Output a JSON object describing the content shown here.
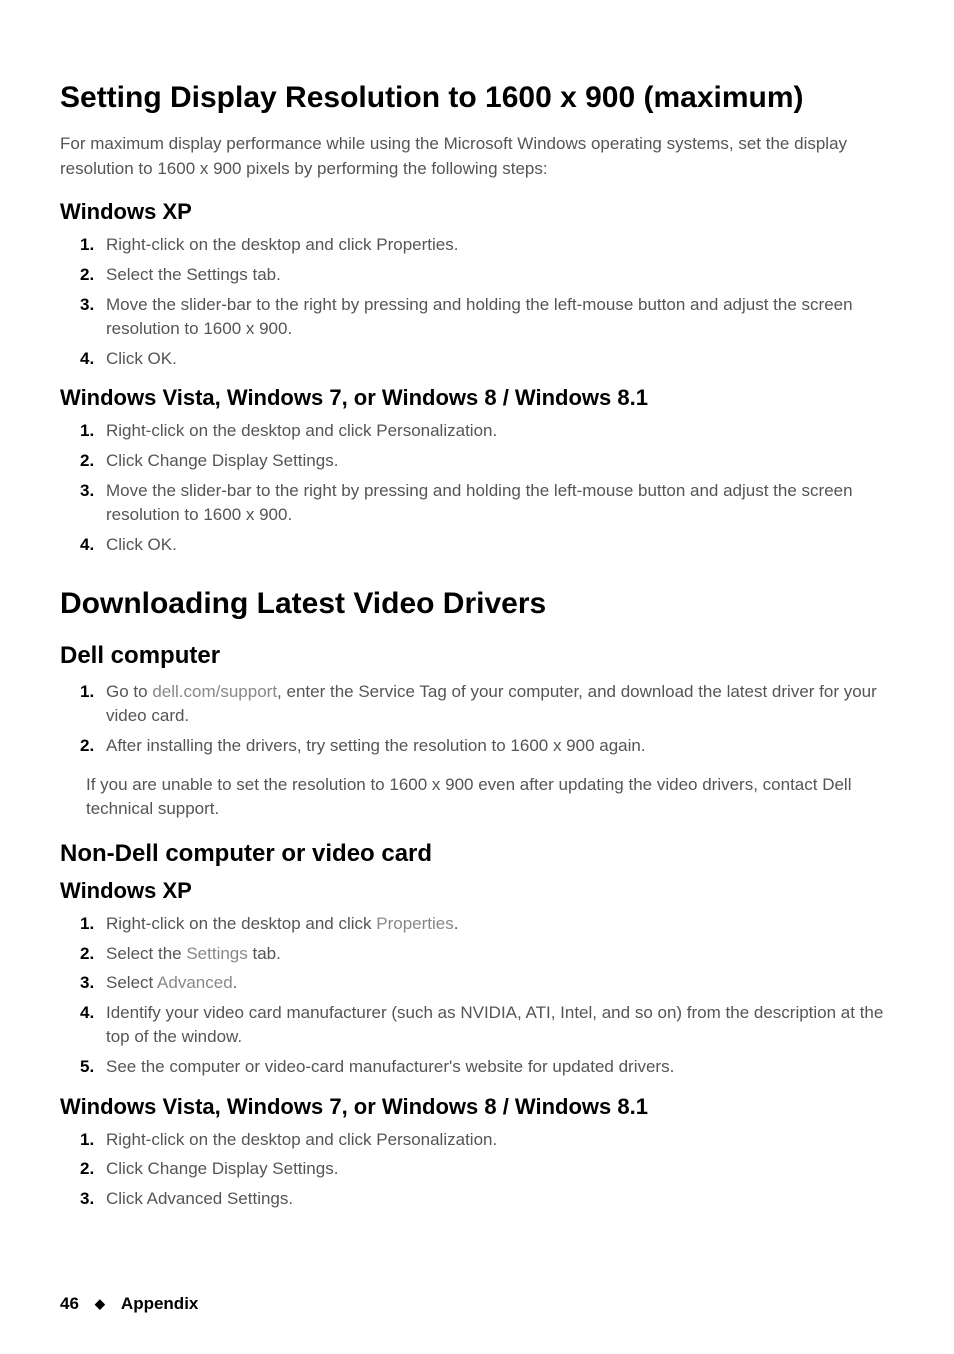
{
  "section1": {
    "title": "Setting Display Resolution to 1600 x 900 (maximum)",
    "intro": "For maximum display performance while using the Microsoft Windows operating systems, set the display resolution to 1600 x 900 pixels by performing the following steps:",
    "xp": {
      "heading": "Windows XP",
      "steps": [
        "Right-click on the desktop and click Properties.",
        "Select the Settings tab.",
        "Move the slider-bar to the right by pressing and holding the left-mouse button and adjust the screen resolution to 1600 x 900.",
        "Click OK."
      ]
    },
    "vista": {
      "heading": "Windows Vista, Windows 7, or Windows 8 / Windows 8.1",
      "steps": [
        "Right-click on the desktop and click Personalization.",
        "Click Change Display Settings.",
        "Move the slider-bar to the right by pressing and holding the left-mouse button and adjust the screen resolution to 1600 x 900.",
        "Click OK."
      ]
    }
  },
  "section2": {
    "title": "Downloading Latest Video Drivers",
    "dell": {
      "heading": "Dell computer",
      "step1_pre": "Go to ",
      "step1_link": "dell.com/support",
      "step1_post": ", enter the Service Tag of your computer, and download the latest driver for your video card.",
      "step2": "After installing the drivers, try setting the resolution to 1600 x 900 again.",
      "note": "If you are unable to set the resolution to 1600 x 900 even after updating the video drivers, contact Dell technical support."
    },
    "nondell": {
      "heading": "Non-Dell computer or video card",
      "xp": {
        "heading": "Windows XP",
        "step1_pre": "Right-click on the desktop and click ",
        "step1_em": "Properties",
        "step1_post": ".",
        "step2_pre": "Select the ",
        "step2_em": "Settings",
        "step2_post": " tab.",
        "step3_pre": "Select ",
        "step3_em": "Advanced",
        "step3_post": ".",
        "step4": "Identify your video card manufacturer (such as NVIDIA, ATI, Intel, and so on) from the description at the top of the window.",
        "step5": "See the computer or video-card manufacturer's website for updated drivers."
      },
      "vista": {
        "heading": "Windows Vista, Windows 7, or Windows 8 / Windows 8.1",
        "steps": [
          "Right-click on the desktop and click Personalization.",
          "Click Change Display Settings.",
          "Click Advanced Settings."
        ]
      }
    }
  },
  "footer": {
    "page": "46",
    "section": "Appendix"
  }
}
